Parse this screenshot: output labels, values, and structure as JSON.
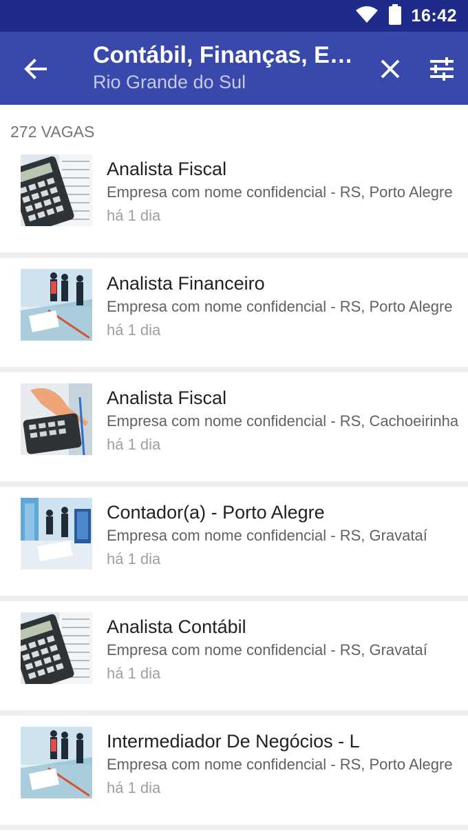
{
  "status_bar": {
    "time": "16:42",
    "icons": [
      "wifi-icon",
      "battery-icon"
    ]
  },
  "app_bar": {
    "title": "Contábil, Finanças, Economia",
    "subtitle": "Rio Grande do Sul",
    "icons": [
      "back-arrow-icon",
      "close-icon",
      "filter-icon"
    ]
  },
  "colors": {
    "status_bar": "#1f2b8a",
    "app_bar": "#3949ab"
  },
  "list": {
    "count": "272 VAGAS",
    "items": [
      {
        "title": "Analista Fiscal",
        "company": "Empresa com nome confidencial - RS, Porto Alegre",
        "posted": "há 1 dia",
        "thumb": "calculator"
      },
      {
        "title": "Analista Financeiro",
        "company": "Empresa com nome confidencial - RS, Porto Alegre",
        "posted": "há 1 dia",
        "thumb": "business-people"
      },
      {
        "title": "Analista Fiscal",
        "company": "Empresa com nome confidencial - RS, Cachoeirinha",
        "posted": "há 1 dia",
        "thumb": "hand-calculator"
      },
      {
        "title": "Contador(a) - Porto Alegre",
        "company": "Empresa com nome confidencial - RS, Gravataí",
        "posted": "há 1 dia",
        "thumb": "office"
      },
      {
        "title": "Analista Contábil",
        "company": "Empresa com nome confidencial - RS, Gravataí",
        "posted": "há 1 dia",
        "thumb": "calculator"
      },
      {
        "title": "Intermediador De Negócios - L",
        "company": "Empresa com nome confidencial - RS, Porto Alegre",
        "posted": "há 1 dia",
        "thumb": "business-people"
      }
    ]
  }
}
